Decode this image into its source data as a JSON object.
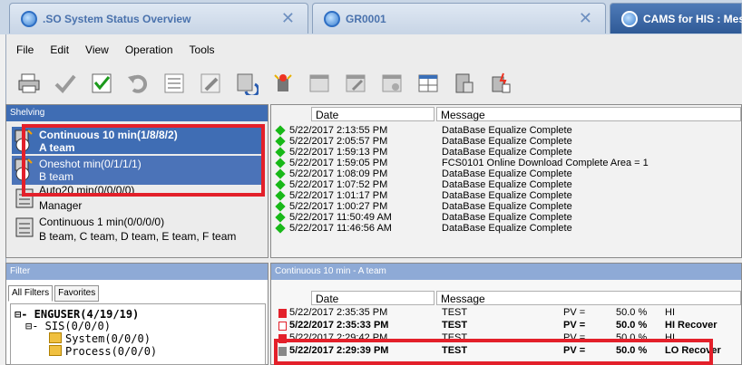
{
  "tabs": [
    {
      "label": ".SO System Status Overview",
      "close": "✕"
    },
    {
      "label": "GR0001",
      "close": "✕"
    },
    {
      "label": "CAMS for HIS : Mes"
    }
  ],
  "menu": [
    "File",
    "Edit",
    "View",
    "Operation",
    "Tools"
  ],
  "toolbar_icons": [
    "printer-icon",
    "check-icon",
    "check-list-icon",
    "undo-icon",
    "list-icon",
    "pencil-icon",
    "refresh-icon",
    "alarm-icon",
    "window-icon",
    "window-edit-icon",
    "window-config-icon",
    "grid-window-icon",
    "server-icon",
    "server-alarm-icon"
  ],
  "shelving": {
    "title": "Shelving",
    "items": [
      {
        "line1": "Continuous 10 min(1/8/8/2)",
        "line2": "A team"
      },
      {
        "line1": "Oneshot min(0/1/1/1)",
        "line2": "B team"
      },
      {
        "line1": "Auto20 min(0/0/0/0)",
        "line2": "Manager"
      },
      {
        "line1": "Continuous 1 min(0/0/0/0)",
        "line2": "B team, C team, D team, E team, F team"
      }
    ]
  },
  "messages": {
    "headers": {
      "date": "Date",
      "message": "Message"
    },
    "rows": [
      {
        "date": "5/22/2017 2:13:55 PM",
        "msg": "DataBase Equalize Complete"
      },
      {
        "date": "5/22/2017 2:05:57 PM",
        "msg": "DataBase Equalize Complete"
      },
      {
        "date": "5/22/2017 1:59:13 PM",
        "msg": "DataBase Equalize Complete"
      },
      {
        "date": "5/22/2017 1:59:05 PM",
        "msg": "FCS0101  Online Download Complete Area = 1"
      },
      {
        "date": "5/22/2017 1:08:09 PM",
        "msg": "DataBase Equalize Complete"
      },
      {
        "date": "5/22/2017 1:07:52 PM",
        "msg": "DataBase Equalize Complete"
      },
      {
        "date": "5/22/2017 1:01:17 PM",
        "msg": "DataBase Equalize Complete"
      },
      {
        "date": "5/22/2017 1:00:27 PM",
        "msg": "DataBase Equalize Complete"
      },
      {
        "date": "5/22/2017 11:50:49 AM",
        "msg": "DataBase Equalize Complete"
      },
      {
        "date": "5/22/2017 11:46:56 AM",
        "msg": "DataBase Equalize Complete"
      }
    ]
  },
  "filter": {
    "title": "Filter",
    "tabs": [
      "All Filters",
      "Favorites"
    ],
    "tree": [
      {
        "text": "⊟-  ENGUSER(4/19/19)"
      },
      {
        "text": "⊟-  SIS(0/0/0)"
      },
      {
        "text": "System(0/0/0)"
      },
      {
        "text": "Process(0/0/0)"
      }
    ]
  },
  "detail": {
    "title": "Continuous 10 min - A team",
    "headers": {
      "date": "Date",
      "message": "Message"
    },
    "rows": [
      {
        "date": "5/22/2017 2:35:35 PM",
        "tag": "TEST",
        "pv": "PV  =",
        "val": "50.0 %",
        "st": "HI"
      },
      {
        "date": "5/22/2017 2:35:33 PM",
        "tag": "TEST",
        "pv": "PV  =",
        "val": "50.0 %",
        "st": "HI  Recover"
      },
      {
        "date": "5/22/2017 2:29:42 PM",
        "tag": "TEST",
        "pv": "PV  =",
        "val": "50.0 %",
        "st": "HI"
      },
      {
        "date": "5/22/2017 2:29:39 PM",
        "tag": "TEST",
        "pv": "PV  =",
        "val": "50.0 %",
        "st": "LO  Recover"
      }
    ]
  },
  "colors": {
    "accent": "#3f6db4",
    "highlight_box": "#e3202a",
    "ok_marker": "#18b818",
    "alarm_marker": "#e3202a"
  }
}
